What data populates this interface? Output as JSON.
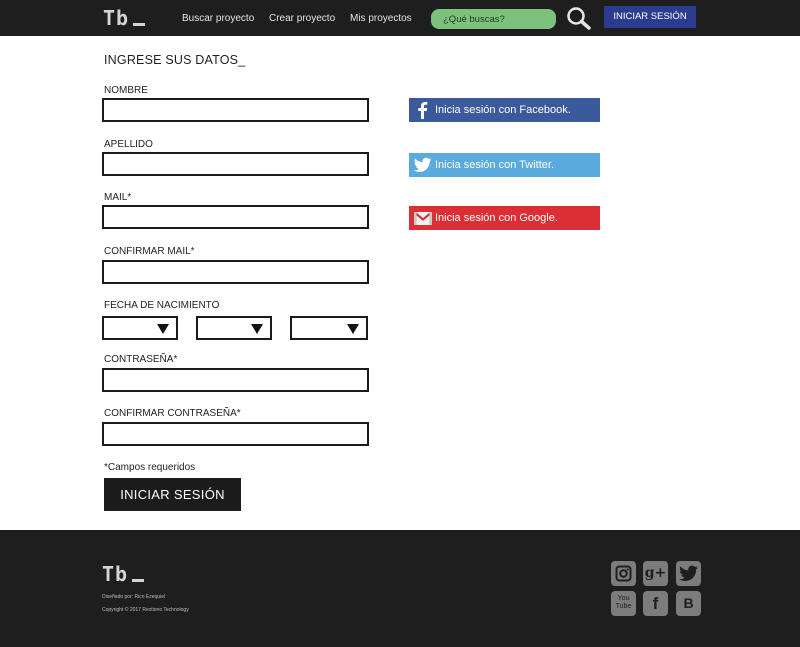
{
  "header": {
    "logo_text": "Tb",
    "nav": [
      "Buscar proyecto",
      "Crear proyecto",
      "Mis proyectos"
    ],
    "search_placeholder": "¿Qué buscas?",
    "search_icon": "magnifier-icon",
    "login_label": "INICIAR SESIÓN"
  },
  "form": {
    "title": "INGRESE SUS DATOS_",
    "labels": {
      "nombre": "NOMBRE",
      "apellido": "APELLIDO",
      "mail": "MAIL*",
      "confirm_mail": "CONFIRMAR MAIL*",
      "birthdate": "FECHA DE NACIMIENTO",
      "password": "CONTRASEÑA*",
      "confirm_password": "CONFIRMAR CONTRASEÑA*"
    },
    "values": {
      "nombre": "",
      "apellido": "",
      "mail": "",
      "confirm_mail": "",
      "password": "",
      "confirm_password": ""
    },
    "birthdate_selects": [
      "",
      "",
      ""
    ],
    "required_note": "*Campos requeridos",
    "submit_label": "INICIAR SESIÓN"
  },
  "social_login": {
    "facebook": {
      "label": "Inicia sesión con Facebook.",
      "icon": "facebook-icon",
      "color": "#3a5a9c"
    },
    "twitter": {
      "label": "Inicia sesión con Twitter.",
      "icon": "twitter-icon",
      "color": "#5aaade"
    },
    "google": {
      "label": "Inicia sesión con Google.",
      "icon": "gmail-icon",
      "color": "#dc2e35"
    }
  },
  "footer": {
    "logo_text": "Tb",
    "designed_by": "Diseñado por: Rico Ezequiel",
    "copyright": "Copyright © 2017 Rextiono Technology",
    "social_icons": [
      "instagram-icon",
      "google-plus-icon",
      "twitter-icon",
      "youtube-icon",
      "facebook-icon",
      "blogger-icon"
    ],
    "google_plus_glyph": "g+",
    "youtube_glyph": "You Tube",
    "facebook_glyph": "f",
    "blogger_glyph": "B"
  },
  "colors": {
    "header_bg": "#1e1e1e",
    "search_bg": "#7cc27c",
    "login_bg": "#2a3c8e",
    "footer_icon_bg": "#7c7c7c"
  }
}
